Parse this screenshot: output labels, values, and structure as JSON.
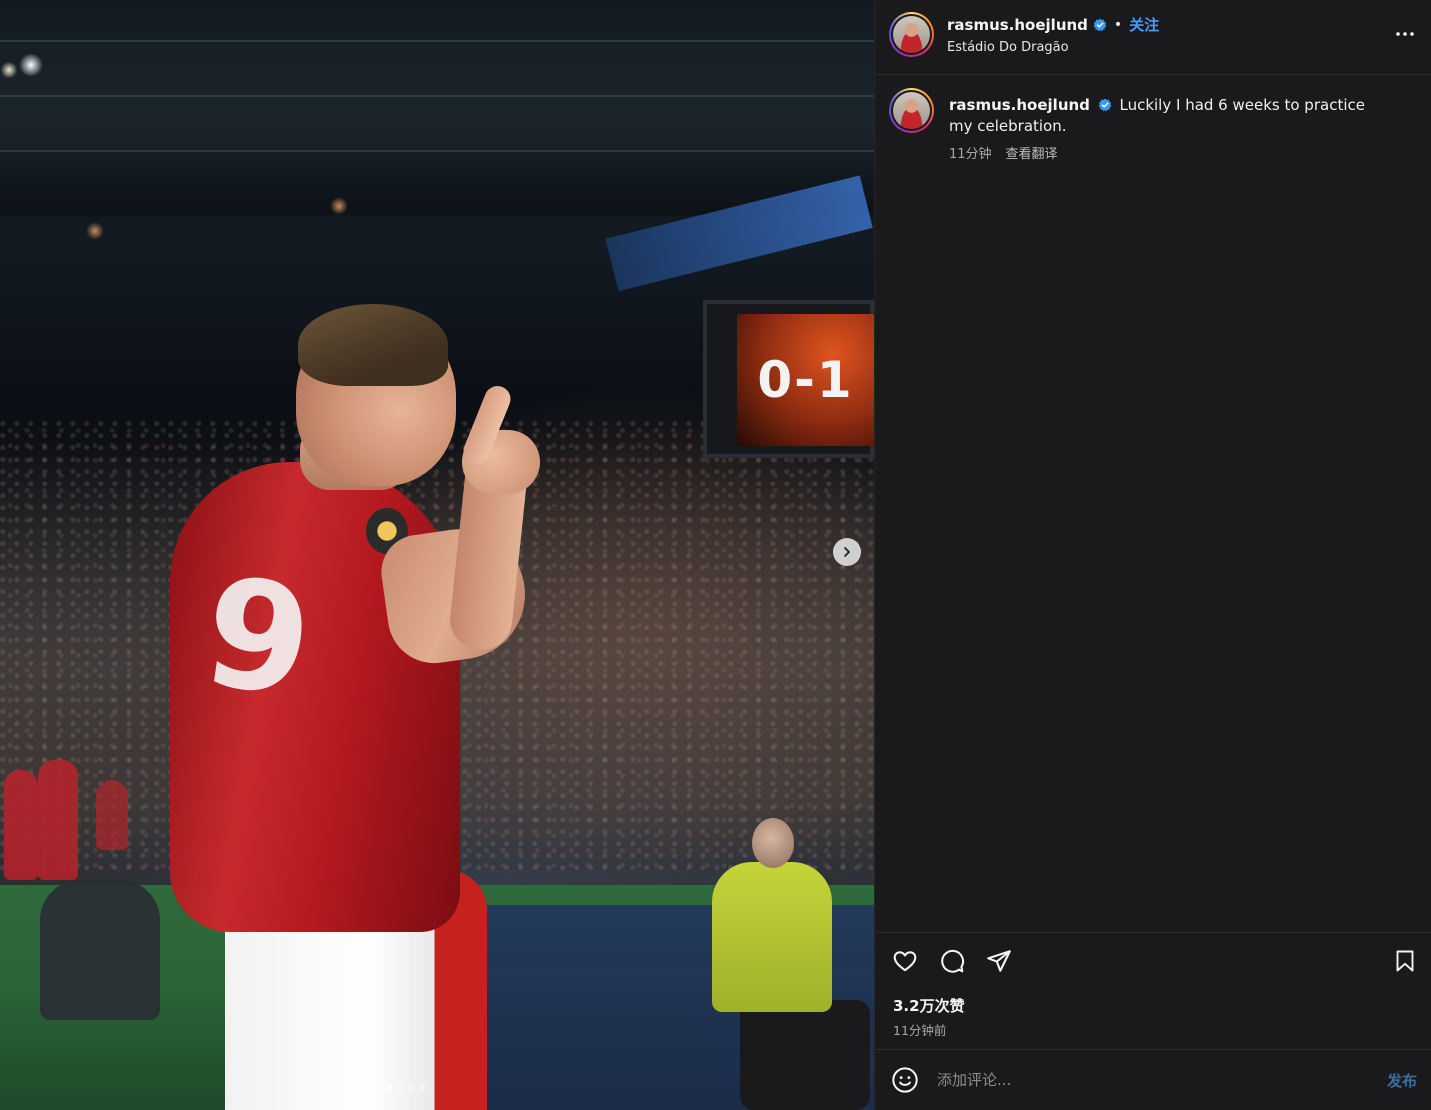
{
  "post": {
    "username": "rasmus.hoejlund",
    "verified": true,
    "follow_label": "关注",
    "separator": "•",
    "location": "Estádio Do Dragão",
    "caption": "Luckily I had 6 weeks to practice my celebration.",
    "caption_time": "11分钟",
    "translate_label": "查看翻译",
    "likes": "3.2万次赞",
    "time_ago": "11分钟前"
  },
  "media": {
    "scoreboard_text": "0-1",
    "shirt_number": "9",
    "carousel": {
      "total": 4,
      "current": 1
    }
  },
  "comment": {
    "placeholder": "添加评论...",
    "post_label": "发布"
  },
  "icons": {
    "more": "more-horizontal-icon",
    "like": "heart-icon",
    "comment": "comment-bubble-icon",
    "share": "paper-plane-icon",
    "save": "bookmark-icon",
    "emoji": "smiley-icon",
    "next": "chevron-right-icon",
    "verified": "verified-badge-icon"
  },
  "colors": {
    "panel_bg": "#1a1a1c",
    "follow": "#4a9cff",
    "verified": "#3897f0",
    "post_button": "#3b6f9e",
    "muted_text": "#a8a8a8"
  }
}
